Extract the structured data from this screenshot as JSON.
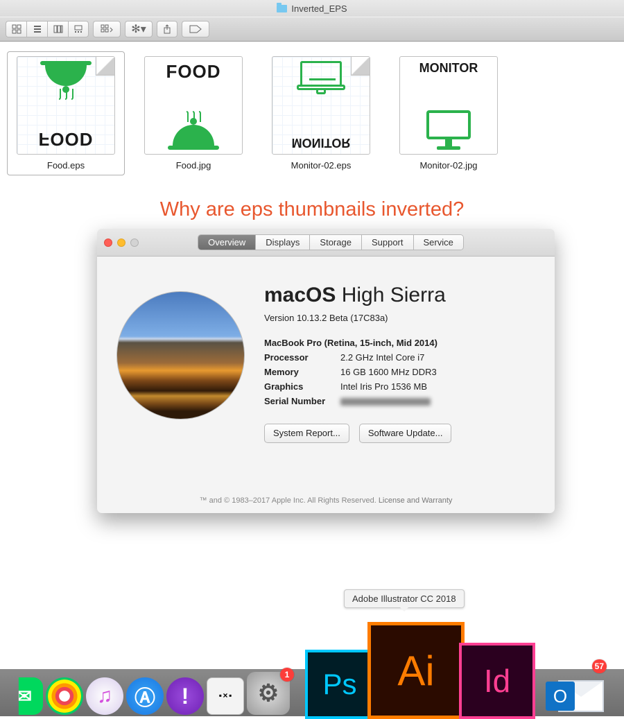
{
  "finder": {
    "title": "Inverted_EPS",
    "files": [
      {
        "name": "Food.eps",
        "label": "FOOD",
        "icon": "food",
        "inverted": true,
        "jpg": false,
        "selected": true
      },
      {
        "name": "Food.jpg",
        "label": "FOOD",
        "icon": "food",
        "inverted": false,
        "jpg": true,
        "selected": false
      },
      {
        "name": "Monitor-02.eps",
        "label": "MONITOR",
        "icon": "cabinet",
        "inverted": true,
        "jpg": false,
        "selected": false
      },
      {
        "name": "Monitor-02.jpg",
        "label": "MONITOR",
        "icon": "monitor",
        "inverted": false,
        "jpg": true,
        "selected": false
      }
    ]
  },
  "question": "Why are eps thumbnails inverted?",
  "about": {
    "tabs": [
      "Overview",
      "Displays",
      "Storage",
      "Support",
      "Service"
    ],
    "active_tab": 0,
    "os_bold": "macOS",
    "os_rest": " High Sierra",
    "version": "Version 10.13.2 Beta (17C83a)",
    "model": "MacBook Pro (Retina, 15-inch, Mid 2014)",
    "spec_processor_k": "Processor",
    "spec_processor_v": "2.2 GHz Intel Core i7",
    "spec_memory_k": "Memory",
    "spec_memory_v": "16 GB 1600 MHz DDR3",
    "spec_graphics_k": "Graphics",
    "spec_graphics_v": "Intel Iris Pro 1536 MB",
    "spec_serial_k": "Serial Number",
    "btn_report": "System Report...",
    "btn_update": "Software Update...",
    "footer_a": "™ and © 1983–2017 Apple Inc. All Rights Reserved. ",
    "footer_b": "License and Warranty"
  },
  "tooltip": "Adobe Illustrator CC 2018",
  "dock": {
    "gear_badge": "1",
    "outlook_badge": "57",
    "ps": "Ps",
    "ai": "Ai",
    "id": "Id",
    "ol": "O"
  }
}
